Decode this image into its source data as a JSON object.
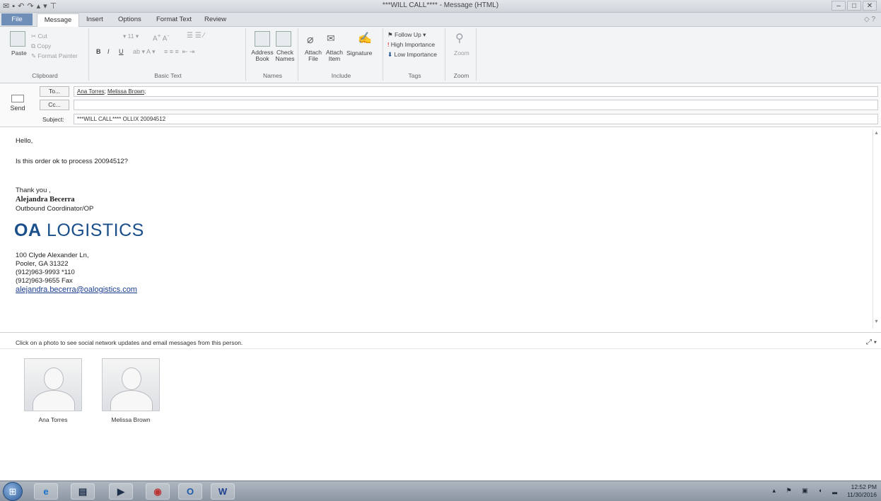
{
  "window": {
    "title": "***WILL CALL**** - Message (HTML)",
    "qat_icons": [
      "outlook-icon",
      "save-icon",
      "undo-icon",
      "redo-icon",
      "up-arrow-icon",
      "down-arrow-icon",
      "customize-icon"
    ]
  },
  "tabs": {
    "file": "File",
    "message": "Message",
    "insert": "Insert",
    "options": "Options",
    "format_text": "Format Text",
    "review": "Review"
  },
  "ribbon": {
    "clipboard": {
      "paste": "Paste",
      "cut": "Cut",
      "copy": "Copy",
      "format_painter": "Format Painter",
      "label": "Clipboard"
    },
    "basic_text": {
      "font_size": "11",
      "bold": "B",
      "italic": "I",
      "underline": "U",
      "label": "Basic Text"
    },
    "names": {
      "address_book": "Address Book",
      "check_names": "Check Names",
      "label": "Names"
    },
    "include": {
      "attach_file": "Attach File",
      "attach_item": "Attach Item",
      "signature": "Signature",
      "label": "Include"
    },
    "tags": {
      "follow_up": "Follow Up",
      "high_importance": "High Importance",
      "low_importance": "Low Importance",
      "label": "Tags"
    },
    "zoom": {
      "zoom": "Zoom",
      "label": "Zoom"
    }
  },
  "header": {
    "send": "Send",
    "to_button": "To...",
    "cc_button": "Cc...",
    "subject_label": "Subject:",
    "to_value_1": "Ana Torres",
    "to_value_2": "Melissa Brown",
    "cc_value": "",
    "subject_value": "***WILL CALL**** OLLIX 20094512"
  },
  "message": {
    "greeting": "Hello,",
    "line1": "Is this order ok to process 20094512?",
    "thanks": "Thank you ,",
    "sender_name": "Alejandra Becerra",
    "sender_title": "Outbound Coordinator/OP",
    "logo_bold": "OA",
    "logo_rest": "LOGISTICS",
    "address1": "100 Clyde Alexander Ln,",
    "address2": "Pooler, GA 31322",
    "phone": "(912)963-9993 *110",
    "fax": "(912)963-9655 Fax",
    "email": "alejandra.becerra@oalogistics.com"
  },
  "people_pane": {
    "hint": "Click on a photo to see social network updates and email messages from this person.",
    "people": [
      "Ana Torres",
      "Melissa Brown"
    ]
  },
  "taskbar": {
    "items": [
      "start-icon",
      "ie-icon",
      "explorer-icon",
      "media-player-icon",
      "chrome-icon",
      "outlook-icon",
      "word-icon"
    ],
    "time": "12:52 PM",
    "date": "11/30/2016"
  },
  "colors": {
    "file_tab": "#6f8fb8",
    "logo": "#1a4f8b",
    "link": "#1a3d8f",
    "taskbar": "#8c96a3"
  }
}
